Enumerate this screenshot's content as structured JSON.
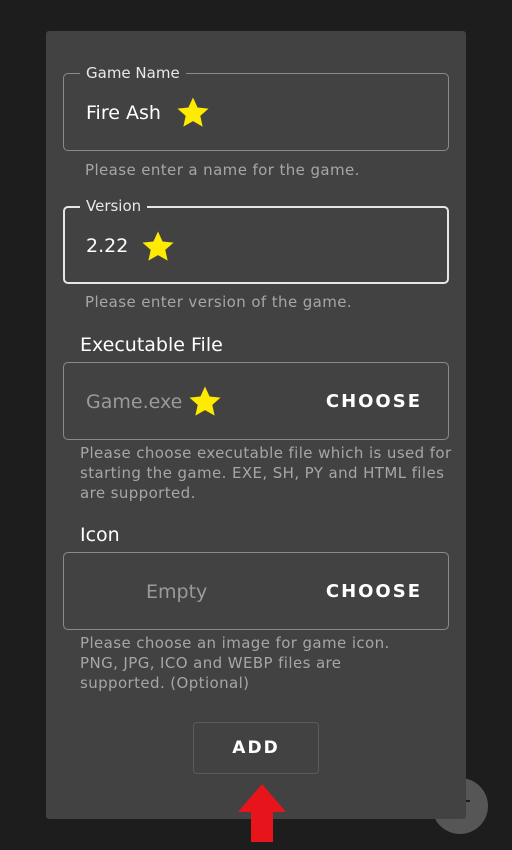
{
  "form": {
    "game_name": {
      "label": "Game Name",
      "value": "Fire Ash",
      "helper": "Please enter a name for the game."
    },
    "version": {
      "label": "Version",
      "value": "2.22",
      "helper": "Please enter version of the game."
    },
    "executable": {
      "label": "Executable File",
      "value": "Game.exe",
      "choose_label": "CHOOSE",
      "helper": "Please choose executable file which is used for starting the game. EXE, SH, PY and HTML files are supported."
    },
    "icon": {
      "label": "Icon",
      "value": "Empty",
      "choose_label": "CHOOSE",
      "helper": "Please choose an image for game icon. PNG, JPG, ICO and WEBP files are supported. (Optional)"
    },
    "add_label": "ADD"
  },
  "annotations": {
    "star_color": "#ffeb00",
    "arrow_color": "#e8141c",
    "star_icon": "star-icon",
    "arrow_icon": "arrow-up-icon"
  }
}
